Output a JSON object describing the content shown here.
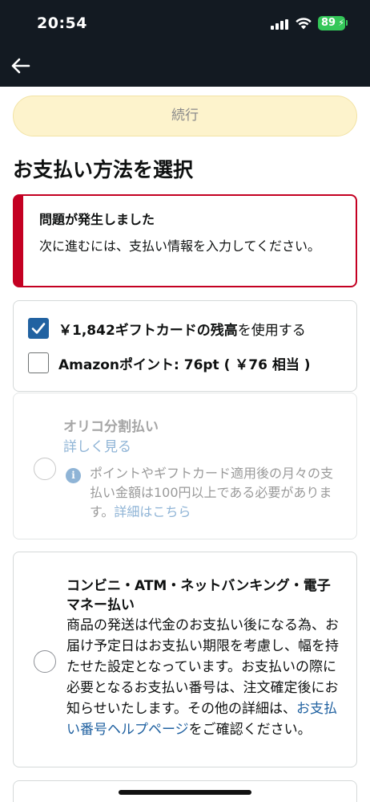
{
  "status_bar": {
    "time": "20:54",
    "battery": "89",
    "icons": [
      "cellular-signal-icon",
      "wifi-icon",
      "battery-charging-icon"
    ]
  },
  "nav": {
    "back_icon": "arrow-left-icon"
  },
  "continue_button": {
    "label": "続行"
  },
  "page_title": "お支払い方法を選択",
  "alert": {
    "title": "問題が発生しました",
    "message": "次に進むには、支払い情報を入力してください。"
  },
  "balances": {
    "gift_card": {
      "checked": true,
      "amount": "￥1,842",
      "bold_label": "ギフトカードの残高",
      "suffix": "を使用する"
    },
    "points": {
      "checked": false,
      "label": "Amazonポイント: 76pt ( ￥76 相当 )"
    }
  },
  "payment_methods": [
    {
      "title": "オリコ分割払い",
      "link": "詳しく見る",
      "disabled": true,
      "info": "ポイントやギフトカード適用後の月々の支払い金額は100円以上である必要があります。",
      "info_link": "詳細はこちら"
    },
    {
      "title": "コンビニ・ATM・ネットバンキング・電子マネー払い",
      "disabled": false,
      "description": "商品の発送は代金のお支払い後になる為、お届け予定日はお支払い期限を考慮し、幅を持たせた設定となっています。お支払いの際に必要となるお支払い番号は、注文確定後にお知らせいたします。その他の詳細は、",
      "link": "お支払い番号ヘルプページ",
      "description_suffix": "をご確認ください。"
    }
  ],
  "colors": {
    "header_bg": "#131a22",
    "button_disabled_bg": "#fdf3cc",
    "alert_red": "#c40022",
    "checkbox_blue": "#2162a1",
    "link_blue": "#2162a1",
    "battery_green": "#34c759"
  }
}
